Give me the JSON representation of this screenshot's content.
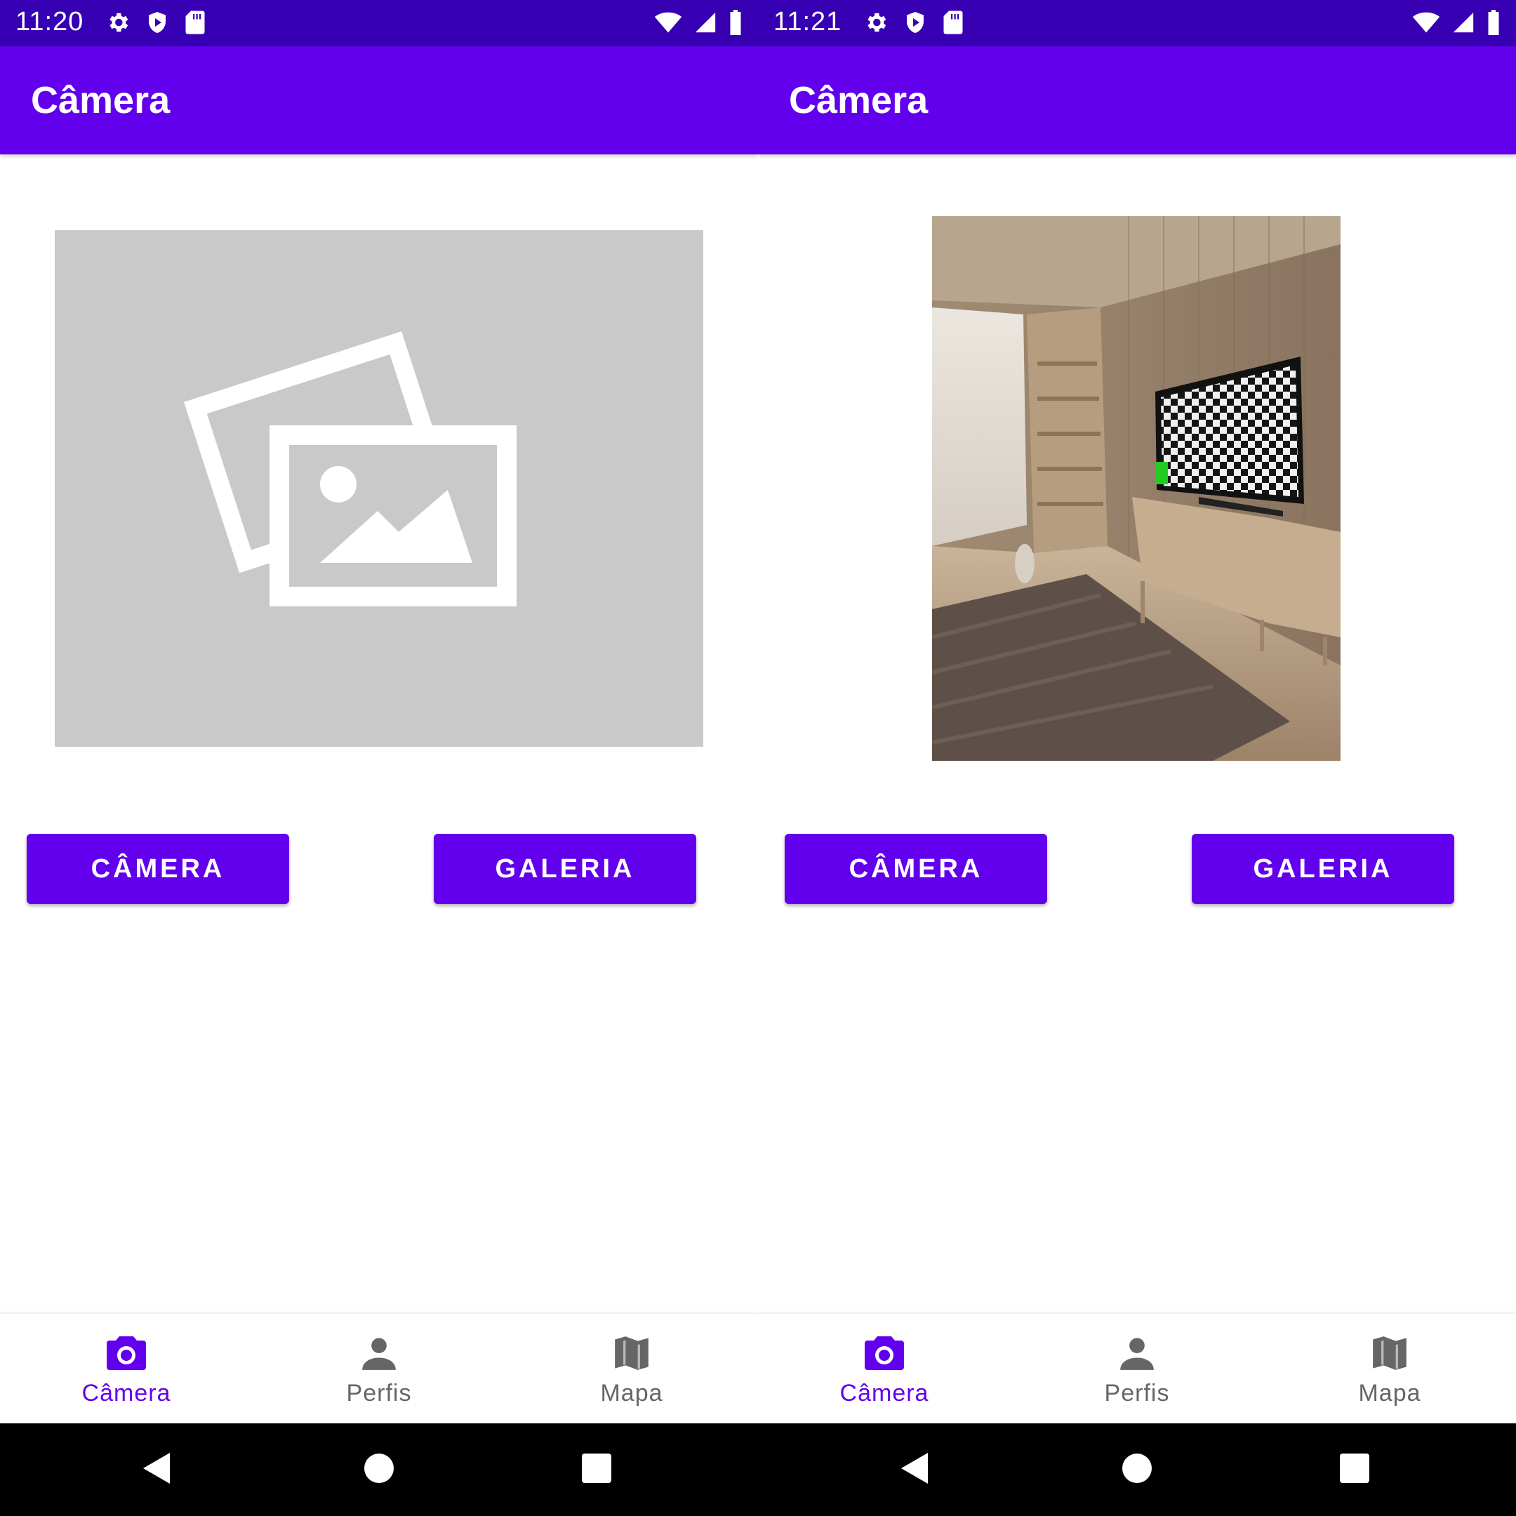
{
  "colors": {
    "status_bar": "#3700b3",
    "primary": "#6200ee",
    "placeholder_bg": "#c9c9c9",
    "nav_inactive": "#666666"
  },
  "screens": [
    {
      "status": {
        "time": "11:20"
      },
      "app_bar": {
        "title": "Câmera"
      },
      "image": {
        "kind": "placeholder",
        "icon": "image-placeholder-icon"
      },
      "buttons": {
        "camera_label": "CÂMERA",
        "gallery_label": "GALERIA"
      },
      "nav": [
        {
          "label": "Câmera",
          "icon": "camera-icon",
          "active": true
        },
        {
          "label": "Perfis",
          "icon": "person-icon",
          "active": false
        },
        {
          "label": "Mapa",
          "icon": "map-icon",
          "active": false
        }
      ]
    },
    {
      "status": {
        "time": "11:21"
      },
      "app_bar": {
        "title": "Câmera"
      },
      "image": {
        "kind": "photo",
        "subject": "living room with TV"
      },
      "buttons": {
        "camera_label": "CÂMERA",
        "gallery_label": "GALERIA"
      },
      "nav": [
        {
          "label": "Câmera",
          "icon": "camera-icon",
          "active": true
        },
        {
          "label": "Perfis",
          "icon": "person-icon",
          "active": false
        },
        {
          "label": "Mapa",
          "icon": "map-icon",
          "active": false
        }
      ]
    }
  ]
}
